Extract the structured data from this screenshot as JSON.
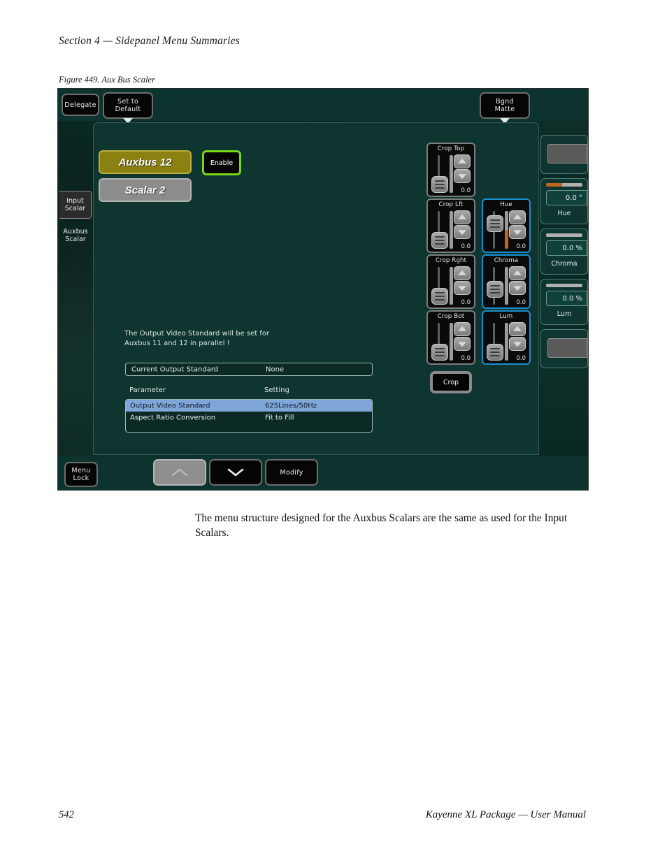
{
  "page": {
    "section_header": "Section 4 — Sidepanel Menu Summaries",
    "figure_caption": "Figure 449.  Aux Bus Scaler",
    "body_paragraph": "The menu structure designed for the Auxbus Scalars are the same as used for the Input Scalars.",
    "footer_page_number": "542",
    "footer_title": "Kayenne XL Package  —  User Manual"
  },
  "colors": {
    "panel_bg": "#0e352f",
    "frame_bg": "#0c2d28",
    "accent_green": "#79d617",
    "accent_blue": "#1a8fd0",
    "accent_orange": "#c4631b",
    "olive_pad": "#8a8112",
    "row_selected": "#7fa5d9"
  },
  "toolbar": {
    "delegate_label": "Delegate",
    "set_to_default_label": "Set to\nDefault",
    "bgnd_matte_label": "Bgnd\nMatte"
  },
  "tabs": [
    {
      "label": "Input\nScalar",
      "active": true
    },
    {
      "label": "Auxbus\nScalar",
      "active": false
    }
  ],
  "main": {
    "source_pad_label": "Auxbus 12",
    "scalar_pad_label": "Scalar 2",
    "enable_label": "Enable",
    "note_text": "The Output Video Standard will be set for\nAuxbus 11 and 12 in parallel !",
    "current_standard": {
      "label": "Current Output Standard",
      "value": "None"
    },
    "table": {
      "headers": {
        "parameter": "Parameter",
        "setting": "Setting"
      },
      "rows": [
        {
          "parameter": "Output Video Standard",
          "setting": "625Lines/50Hz",
          "selected": true
        },
        {
          "parameter": "Aspect Ratio Conversion",
          "setting": "Fit to Fill",
          "selected": false
        }
      ]
    }
  },
  "sliders": [
    {
      "title": "Crop Top",
      "value": "0.0",
      "highlight": false,
      "fill": false
    },
    {
      "title": "Crop Lft",
      "value": "0.0",
      "highlight": false,
      "fill": false
    },
    {
      "title": "Hue",
      "value": "0.0",
      "highlight": true,
      "fill": true
    },
    {
      "title": "Crop Rght",
      "value": "0.0",
      "highlight": false,
      "fill": false
    },
    {
      "title": "Chroma",
      "value": "0.0",
      "highlight": true,
      "fill": false
    },
    {
      "title": "Crop Bot",
      "value": "0.0",
      "highlight": false,
      "fill": false
    },
    {
      "title": "Lum",
      "value": "0.0",
      "highlight": true,
      "fill": false
    }
  ],
  "crop_button_label": "Crop",
  "knobs": [
    {
      "name": "",
      "value": "",
      "blank": true,
      "meter_pct": 0
    },
    {
      "name": "Hue",
      "value": "0.0  °",
      "blank": false,
      "meter_pct": 45
    },
    {
      "name": "Chroma",
      "value": "0.0 %",
      "blank": false,
      "meter_pct": 0
    },
    {
      "name": "Lum",
      "value": "0.0 %",
      "blank": false,
      "meter_pct": 0
    },
    {
      "name": "",
      "value": "",
      "blank": true,
      "meter_pct": 0
    }
  ],
  "bottombar": {
    "menu_lock_label": "Menu\nLock",
    "modify_label": "Modify",
    "page_up_icon": "chevron-up-icon",
    "page_down_icon": "chevron-down-icon"
  }
}
